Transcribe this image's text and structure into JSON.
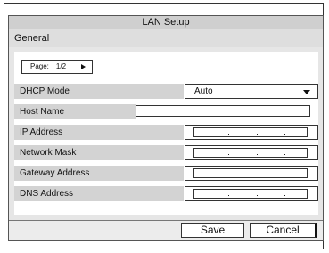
{
  "window": {
    "title": "LAN Setup"
  },
  "section": {
    "title": "General"
  },
  "pager": {
    "label": "Page:",
    "value": "1/2"
  },
  "fields": {
    "dhcp": {
      "label": "DHCP Mode",
      "value": "Auto"
    },
    "host": {
      "label": "Host Name",
      "value": ""
    },
    "ip": {
      "label": "IP Address"
    },
    "mask": {
      "label": "Network Mask"
    },
    "gateway": {
      "label": "Gateway Address"
    },
    "dns": {
      "label": "DNS Address"
    }
  },
  "buttons": {
    "save": "Save",
    "cancel": "Cancel"
  },
  "icons": {
    "pager_next": "triangle-right-icon",
    "dropdown": "caret-down-icon"
  }
}
